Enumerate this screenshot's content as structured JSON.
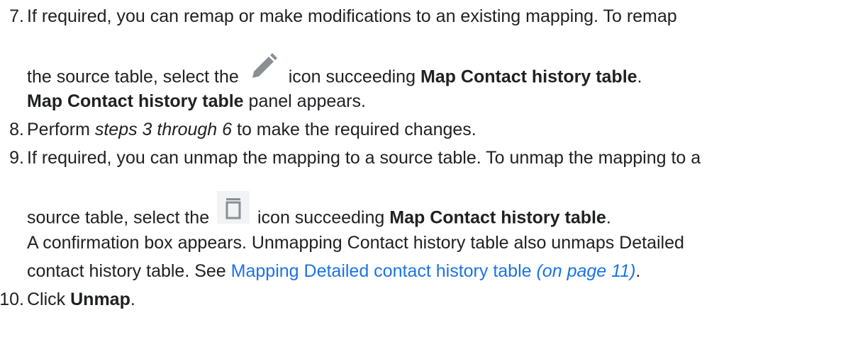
{
  "steps": [
    {
      "number": "7.",
      "line1": "If required, you can remap or make modifications to an existing mapping. To remap",
      "line2_pre": "the source table, select the",
      "line2_icon": "pencil-icon",
      "line2_mid": "icon succeeding",
      "line2_bold": "Map Contact history table",
      "line2_post": ".",
      "line3_bold": "Map Contact history table",
      "line3_post": "panel appears."
    },
    {
      "number": "8.",
      "pre": "Perform",
      "italic": "steps 3 through 6",
      "post": "to make the required changes."
    },
    {
      "number": "9.",
      "line1": "If required, you can unmap the mapping to a source table. To unmap the mapping to a",
      "line2_pre": "source table, select the",
      "line2_icon": "trash-icon",
      "line2_mid": "icon succeeding",
      "line2_bold": "Map Contact history table",
      "line2_post": ".",
      "line3": "A confirmation box appears. Unmapping Contact history table also unmaps Detailed",
      "line4_pre": "contact history table. See",
      "line4_link": "Mapping Detailed contact history table",
      "line4_link_page": "(on page 11)",
      "line4_post": "."
    },
    {
      "number": "10.",
      "pre": "Click",
      "bold": "Unmap",
      "post": "."
    }
  ],
  "colors": {
    "text": "#202124",
    "link": "#1a73e8",
    "icon": "#8a8f94",
    "icon_bg": "#f1f3f4"
  }
}
